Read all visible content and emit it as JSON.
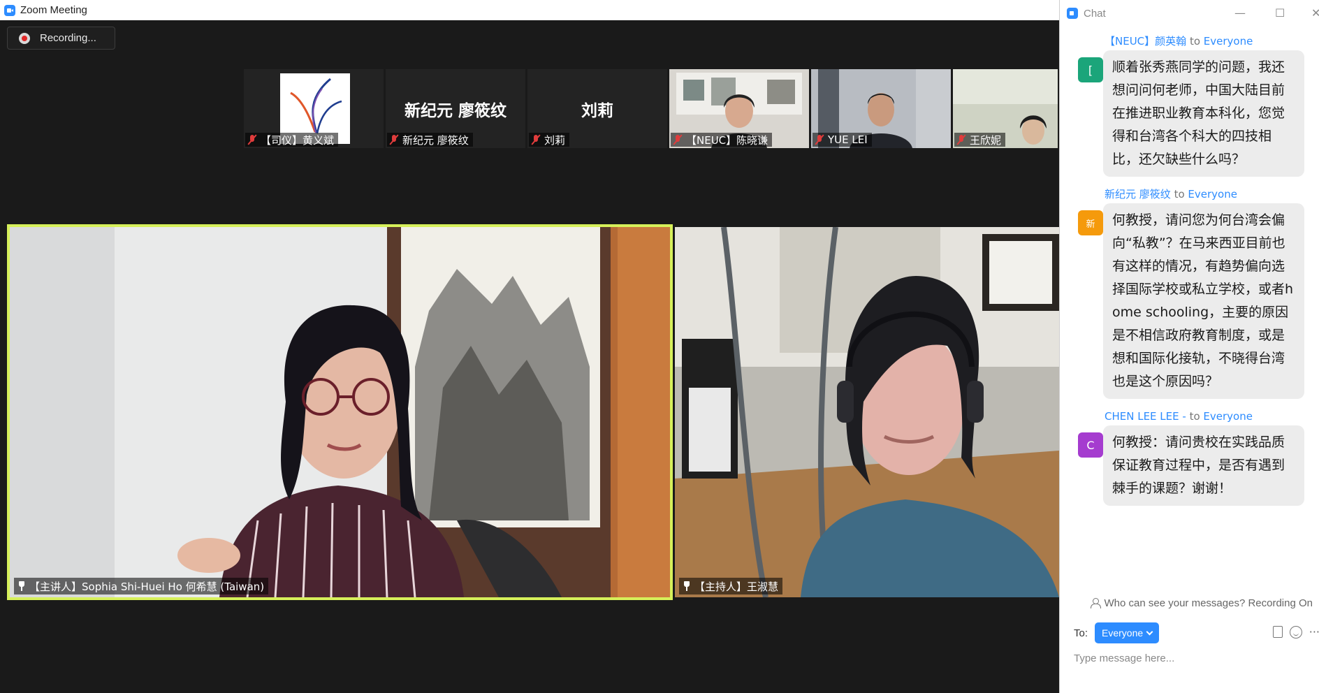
{
  "window": {
    "title": "Zoom Meeting"
  },
  "recording": {
    "label": "Recording..."
  },
  "gallery": [
    {
      "name": "【司仪】黄义斌",
      "big_name": "",
      "muted": true,
      "kind": "logo"
    },
    {
      "name": "新纪元 廖筱纹",
      "big_name": "新纪元 廖筱纹",
      "muted": true,
      "kind": "name"
    },
    {
      "name": "刘莉",
      "big_name": "刘莉",
      "muted": true,
      "kind": "name"
    },
    {
      "name": "【NEUC】陈晓谦",
      "big_name": "",
      "muted": true,
      "kind": "video"
    },
    {
      "name": "YUE LEI",
      "big_name": "",
      "muted": true,
      "kind": "video"
    },
    {
      "name": "王欣妮",
      "big_name": "",
      "muted": true,
      "kind": "video"
    }
  ],
  "main_videos": {
    "left": {
      "name": "【主讲人】Sophia Shi-Huei Ho 何希慧 (Taiwan)",
      "active_speaker": true
    },
    "right": {
      "name": "【主持人】王淑慧"
    }
  },
  "chat": {
    "title": "Chat",
    "messages": [
      {
        "sender": "【NEUC】颜英翰",
        "to_word": "to",
        "recipient": "Everyone",
        "avatar_text": "[",
        "avatar_color": "#1ba57a",
        "text": "顺着张秀燕同学的问题，我还想问问何老师，中国大陆目前在推进职业教育本科化，您觉得和台湾各个科大的四技相比，还欠缺些什么吗？"
      },
      {
        "sender": "新纪元 廖筱纹",
        "to_word": "to",
        "recipient": "Everyone",
        "avatar_text": "新",
        "avatar_color": "#f59a0c",
        "text": "何教授，请问您为何台湾会偏向“私教”？在马来西亚目前也有这样的情况，有趋势偏向选择国际学校或私立学校，或者home schooling，主要的原因是不相信政府教育制度，或是想和国际化接轨，不晓得台湾也是这个原因吗？"
      },
      {
        "sender": "CHEN LEE LEE -",
        "to_word": "to",
        "recipient": "Everyone",
        "avatar_text": "C",
        "avatar_color": "#a53ccf",
        "text": "何教授：请问贵校在实践品质保证教育过程中，是否有遇到棘手的课题？谢谢！"
      }
    ],
    "visibility_notice": "Who can see your messages? Recording On",
    "to_label": "To:",
    "to_value": "Everyone",
    "input_placeholder": "Type message here..."
  }
}
